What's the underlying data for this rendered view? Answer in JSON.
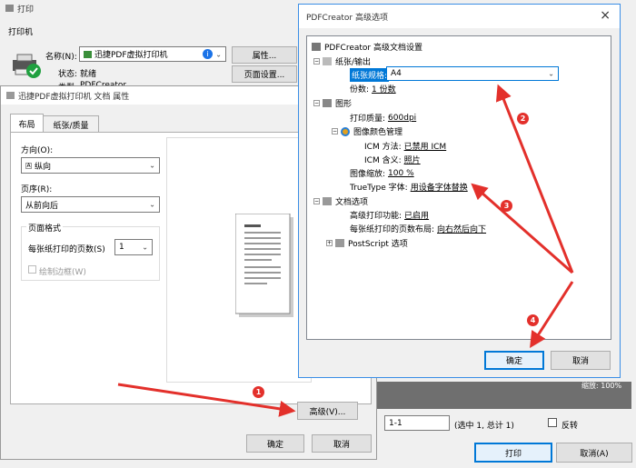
{
  "print_window": {
    "title": "打印",
    "group_printer": "打印机",
    "name_label": "名称(N):",
    "printer_name": "迅捷PDF虚拟打印机",
    "properties_button": "属性...",
    "status_label": "状态:",
    "status_value": "就绪",
    "type_label": "类型:",
    "type_value": "PDFCreator",
    "page_setup_button": "页面设置...",
    "zoom_text": "缩放: 100%",
    "pages_value": "1-1",
    "pages_info": "(选中 1, 总计 1)",
    "reverse_label": "反转",
    "print_button": "打印",
    "cancel_button": "取消(A)"
  },
  "props_dialog": {
    "title": "迅捷PDF虚拟打印机 文档 属性",
    "tab_layout": "布局",
    "tab_paper": "纸张/质量",
    "orientation_label": "方向(O):",
    "orientation_value": "纵向",
    "order_label": "页序(R):",
    "order_value": "从前向后",
    "format_group": "页面格式",
    "pages_per_sheet_label": "每张纸打印的页数(S)",
    "pages_per_sheet_value": "1",
    "draw_borders_label": "绘制边框(W)",
    "advanced_button": "高级(V)...",
    "ok_button": "确定",
    "cancel_button": "取消"
  },
  "advanced_dialog": {
    "title": "PDFCreator 高级选项",
    "close_icon": "×",
    "root": "PDFCreator 高级文档设置",
    "paper_output": "纸张/输出",
    "paper_size_label": "纸张规格:",
    "paper_size_value": "A4",
    "copies_label": "份数:",
    "copies_value": "1 份数",
    "graphics": "图形",
    "print_quality_label": "打印质量:",
    "print_quality_value": "600dpi",
    "icm_group": "图像颜色管理",
    "icm_method_label": "ICM 方法:",
    "icm_method_value": "已禁用 ICM",
    "icm_intent_label": "ICM 含义:",
    "icm_intent_value": "照片",
    "scaling_label": "图像缩放:",
    "scaling_value": "100 %",
    "truetype_label": "TrueType 字体:",
    "truetype_value": "用设备字体替换",
    "doc_options": "文档选项",
    "adv_print_label": "高级打印功能:",
    "adv_print_value": "已启用",
    "layout_label": "每张纸打印的页数布局:",
    "layout_value": "向右然后向下",
    "postscript": "PostScript 选项",
    "ok_button": "确定",
    "cancel_button": "取消"
  },
  "annotations": {
    "badge1": "1",
    "badge2": "2",
    "badge3": "3",
    "badge4": "4",
    "color": "#e3302b"
  }
}
